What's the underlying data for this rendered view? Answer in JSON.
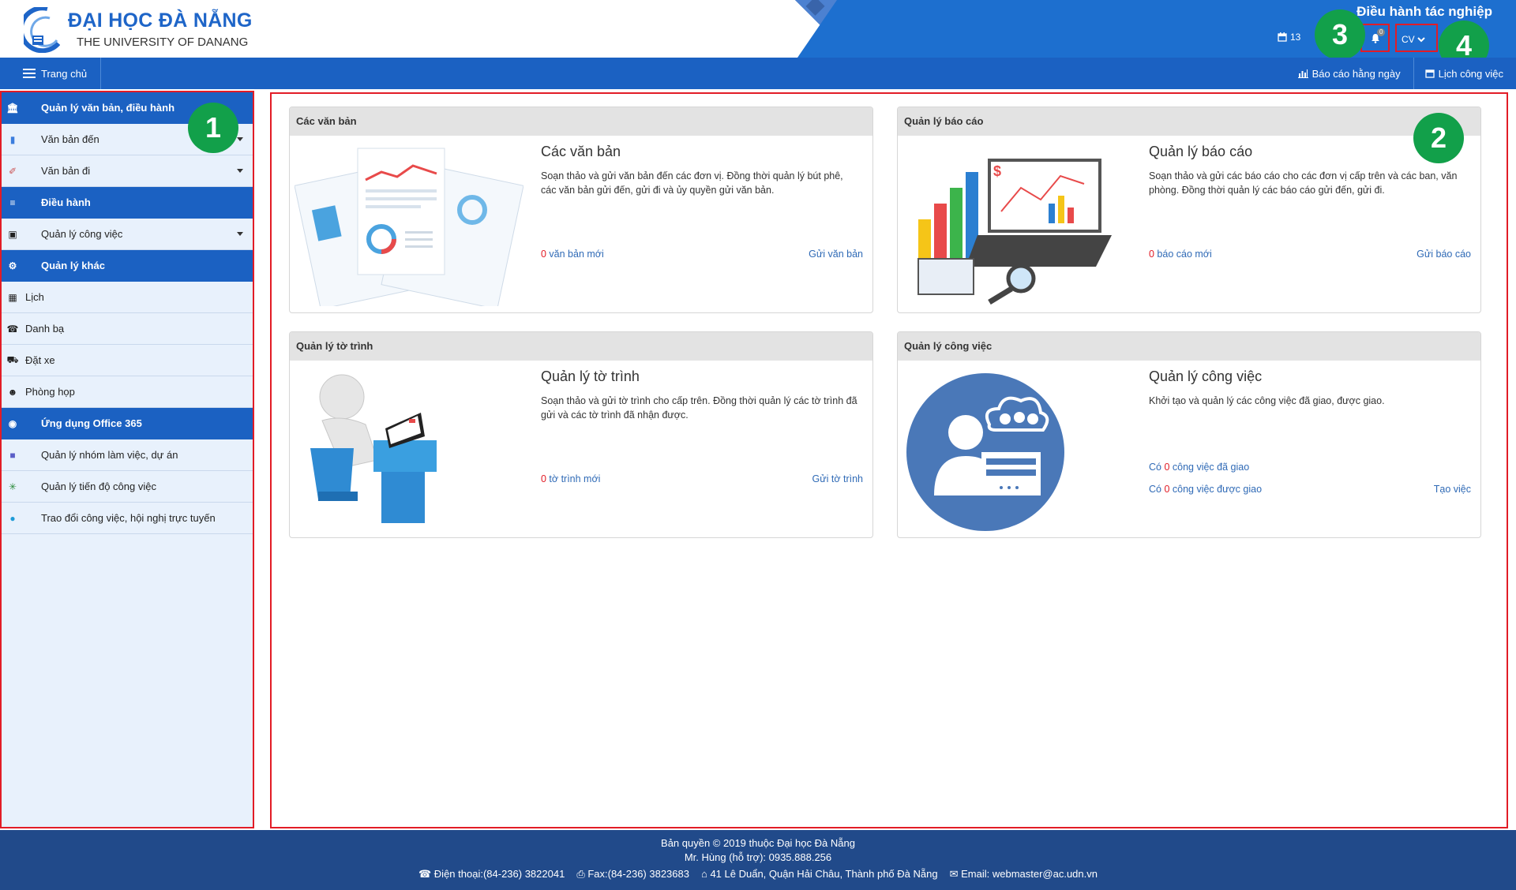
{
  "header": {
    "brand_title": "ĐẠI HỌC ĐÀ NẴNG",
    "brand_subtitle": "THE UNIVERSITY OF DANANG",
    "system_title": "Điều hành tác nghiệp",
    "date_partial": "13",
    "notification_count": "0",
    "user_label": "CV"
  },
  "navbar": {
    "home_label": "Trang chủ",
    "daily_report_label": "Báo cáo hằng ngày",
    "work_calendar_label": "Lịch công việc"
  },
  "annotations": {
    "sidebar": "1",
    "content": "2",
    "notifications": "3",
    "user_menu": "4"
  },
  "sidebar": {
    "items": [
      {
        "label": "Quản lý văn bản, điều hành",
        "type": "header",
        "icon": "bank-icon"
      },
      {
        "label": "Văn bản đến",
        "type": "item",
        "icon": "document-icon",
        "dropdown": true
      },
      {
        "label": "Văn bản đi",
        "type": "item",
        "icon": "send-document-icon",
        "dropdown": true
      },
      {
        "label": "Điều hành",
        "type": "header",
        "icon": "sliders-icon"
      },
      {
        "label": "Quản lý công việc",
        "type": "item",
        "icon": "briefcase-icon",
        "dropdown": true
      },
      {
        "label": "Quản lý khác",
        "type": "header",
        "icon": "cogs-icon"
      },
      {
        "label": "Lịch",
        "type": "sub",
        "icon": "calendar-icon"
      },
      {
        "label": "Danh bạ",
        "type": "sub",
        "icon": "phone-book-icon"
      },
      {
        "label": "Đặt xe",
        "type": "sub",
        "icon": "car-icon"
      },
      {
        "label": "Phòng họp",
        "type": "sub",
        "icon": "users-icon"
      },
      {
        "label": "Ứng dụng Office 365",
        "type": "header",
        "icon": "globe-icon"
      },
      {
        "label": "Quản lý nhóm làm việc, dự án",
        "type": "item",
        "icon": "teams-icon"
      },
      {
        "label": "Quản lý tiến độ công việc",
        "type": "item",
        "icon": "planner-icon"
      },
      {
        "label": "Trao đổi công việc, hội nghị trực tuyến",
        "type": "item",
        "icon": "skype-icon"
      }
    ]
  },
  "cards": {
    "documents": {
      "header": "Các văn bản",
      "title": "Các văn bản",
      "desc": "Soạn thảo và gửi văn bản đến các đơn vị. Đồng thời quản lý bút phê, các văn bản gửi đến, gửi đi và ủy quyền gửi văn bản.",
      "count": "0",
      "count_label": " văn bản mới",
      "action": "Gửi văn bản"
    },
    "reports": {
      "header": "Quản lý báo cáo",
      "title": "Quản lý báo cáo",
      "desc": "Soạn thảo và gửi các báo cáo cho các đơn vị cấp trên và các ban, văn phòng. Đồng thời quản lý các báo cáo gửi đến, gửi đi.",
      "count": "0",
      "count_label": " báo cáo mới",
      "action": "Gửi báo cáo"
    },
    "submissions": {
      "header": "Quản lý tờ trình",
      "title": "Quản lý tờ trình",
      "desc": "Soạn thảo và gửi tờ trình cho cấp trên. Đồng thời quản lý các tờ trình đã gửi và các tờ trình đã nhận được.",
      "count": "0",
      "count_label": " tờ trình mới",
      "action": "Gửi tờ trình"
    },
    "tasks": {
      "header": "Quản lý công việc",
      "title": "Quản lý công việc",
      "desc": "Khởi tạo và quản lý các công việc đã giao, được giao.",
      "assigned_prefix": "Có ",
      "assigned_count": "0",
      "assigned_label": " công việc đã giao",
      "received_prefix": "Có ",
      "received_count": "0",
      "received_label": " công việc được giao",
      "action": "Tạo việc"
    }
  },
  "footer": {
    "copyright": "Bản quyền © 2019 thuộc Đại học Đà Nẵng",
    "support": "Mr. Hùng (hỗ trợ): 0935.888.256",
    "phone": "Điện thoại:(84-236) 3822041",
    "fax": "Fax:(84-236) 3823683",
    "address": "41 Lê Duẩn, Quận Hải Châu, Thành phố Đà Nẵng",
    "email": "Email: webmaster@ac.udn.vn"
  },
  "colors": {
    "primary": "#1b61c2",
    "header_band": "#1d6fcf",
    "annotation_border": "#e21c26",
    "badge": "#12a04a",
    "footer": "#214a8a",
    "sidebar_bg": "#e8f1fc"
  }
}
